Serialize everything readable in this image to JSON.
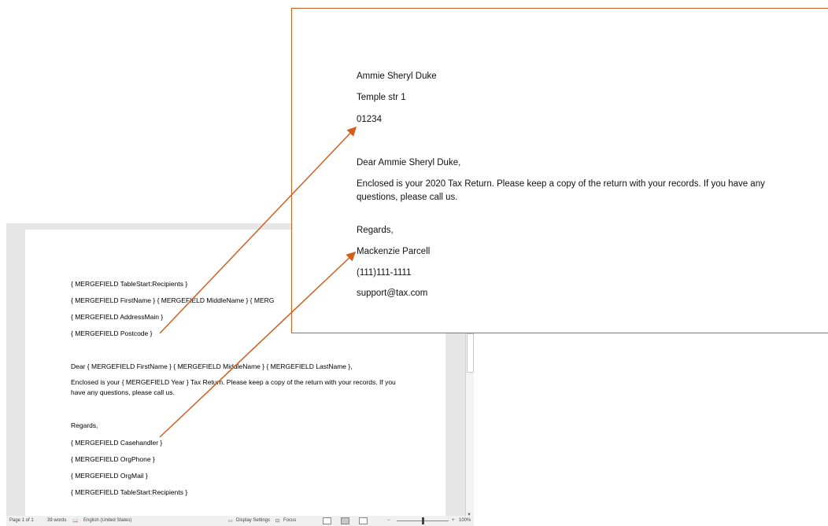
{
  "template": {
    "lines": {
      "tablestart_top": "{ MERGEFIELD TableStart:Recipients }",
      "name_line": "{ MERGEFIELD FirstName } { MERGEFIELD MiddleName } { MERG",
      "address": "{ MERGEFIELD AddressMain }",
      "postcode": "{ MERGEFIELD Postcode }",
      "dear": "Dear { MERGEFIELD FirstName } { MERGEFIELD MiddleName } { MERGEFIELD LastName },",
      "body": "Enclosed is your { MERGEFIELD Year } Tax Return. Please keep a copy of the return with your records. If you have any questions, please call us.",
      "regards": "Regards,",
      "casehandler": "{ MERGEFIELD Casehandler }",
      "orgphone": "{ MERGEFIELD OrgPhone }",
      "orgmail": "{ MERGEFIELD OrgMail }",
      "tablestart_bottom": "{ MERGEFIELD TableStart:Recipients }"
    }
  },
  "status_bar": {
    "page": "Page 1 of 1",
    "words": "39 words",
    "language": "English (United States)",
    "display_settings": "Display Settings",
    "focus": "Focus",
    "zoom_minus": "−",
    "zoom_plus": "+",
    "zoom_level": "100%"
  },
  "preview": {
    "name": "Ammie Sheryl Duke",
    "address": "Temple str 1",
    "postcode": "01234",
    "greeting": "Dear Ammie Sheryl Duke,",
    "body": "Enclosed is your 2020 Tax Return. Please keep a copy of the return with your records. If you have any questions, please call us.",
    "regards": "Regards,",
    "signer": "Mackenzie Parcell",
    "phone": "(111)111-1111",
    "email": "support@tax.com"
  },
  "colors": {
    "accent": "#d15f1e"
  }
}
